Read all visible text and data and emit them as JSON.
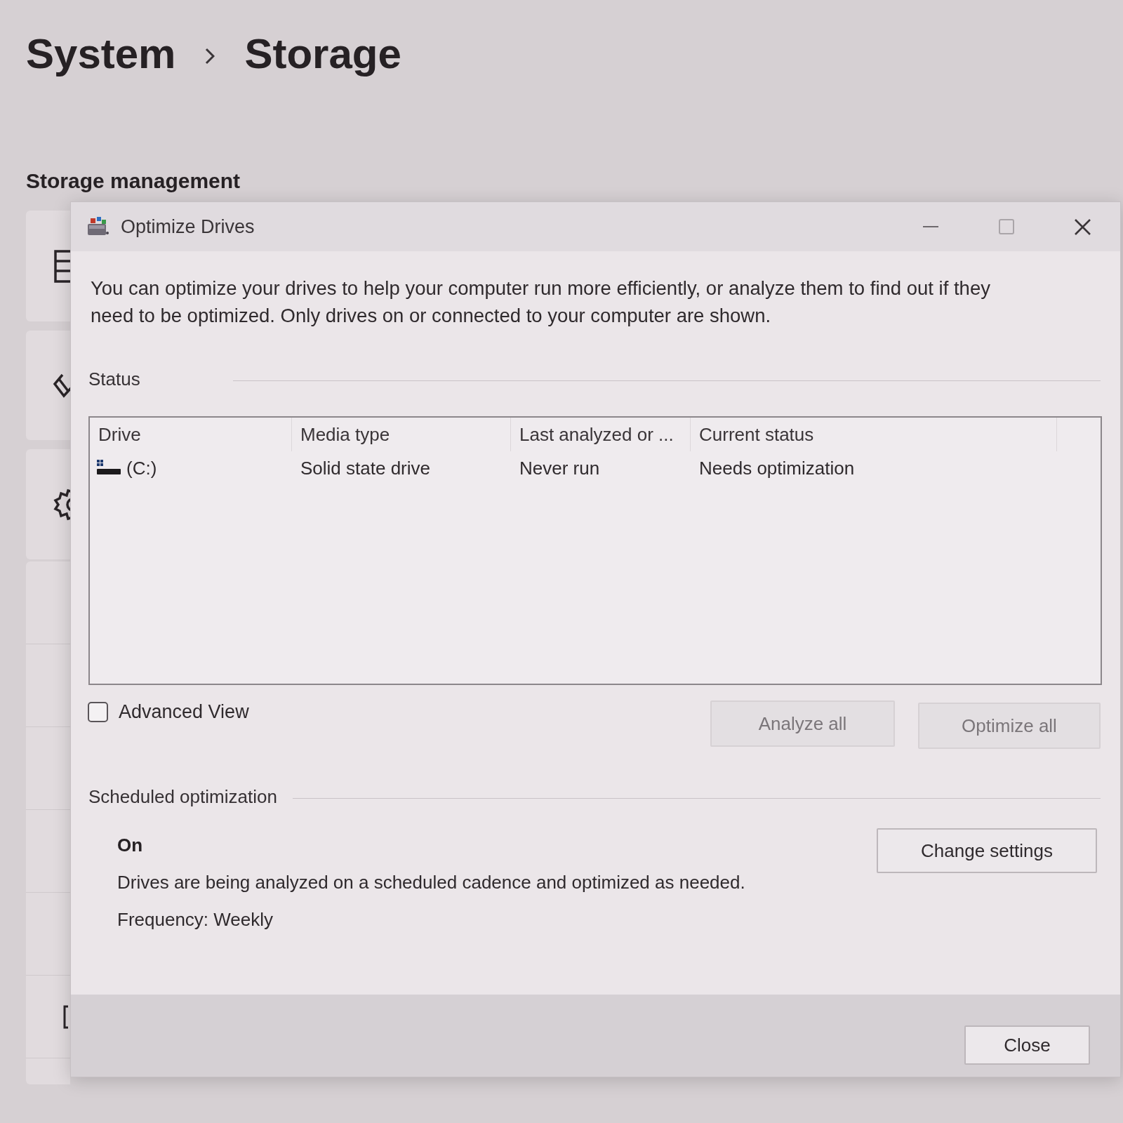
{
  "breadcrumb": [
    {
      "label": "System"
    },
    {
      "label": "Storage"
    }
  ],
  "section_title": "Storage management",
  "dialog": {
    "title": "Optimize Drives",
    "window_controls": [
      {
        "kind": "minimize",
        "disabled": false
      },
      {
        "kind": "maximize",
        "disabled": true
      },
      {
        "kind": "close",
        "disabled": false
      }
    ],
    "description": "You can optimize your drives to help your computer run more efficiently, or analyze them to find out if they need to be optimized. Only drives on or connected to your computer are shown.",
    "status": {
      "label": "Status",
      "columns": [
        "Drive",
        "Media type",
        "Last analyzed or ...",
        "Current status"
      ],
      "rows": [
        {
          "drive": "(C:)",
          "media_type": "Solid state drive",
          "last_analyzed": "Never run",
          "current_status": "Needs optimization"
        }
      ]
    },
    "advanced_view": {
      "label": "Advanced View",
      "checked": false
    },
    "actions": [
      {
        "label": "Analyze all",
        "disabled": true
      },
      {
        "label": "Optimize all",
        "disabled": true
      }
    ],
    "scheduled_optimization": {
      "label": "Scheduled optimization",
      "state": "On",
      "description": "Drives are being analyzed on a scheduled cadence and optimized as needed.",
      "frequency": "Frequency: Weekly",
      "button": {
        "label": "Change settings",
        "disabled": false
      }
    },
    "close_button": {
      "label": "Close",
      "disabled": false
    }
  }
}
